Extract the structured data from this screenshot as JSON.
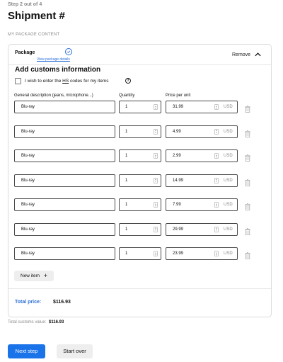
{
  "header": {
    "step": "Step 2 out of 4",
    "title": "Shipment #"
  },
  "section_label": "MY PACKAGE CONTENT",
  "package": {
    "title": "Package",
    "view_details": "View package details",
    "remove_label": "Remove"
  },
  "customs": {
    "title": "Add customs information",
    "hs_label_prefix": "I wish to enter the ",
    "hs_abbr": "HS",
    "hs_label_suffix": " codes for my items",
    "help_glyph": "?",
    "columns": {
      "description": "General description (jeans, microphone...)",
      "quantity": "Quantity",
      "price": "Price per unit"
    },
    "currency": "USD",
    "items": [
      {
        "description": "Blu-ray",
        "quantity": "1",
        "price": "31.99"
      },
      {
        "description": "Blu-ray",
        "quantity": "1",
        "price": "4.99"
      },
      {
        "description": "Blu-ray",
        "quantity": "1",
        "price": "2.99"
      },
      {
        "description": "Blu-ray",
        "quantity": "1",
        "price": "14.99"
      },
      {
        "description": "Blu-ray",
        "quantity": "1",
        "price": "7.99"
      },
      {
        "description": "Blu-ray",
        "quantity": "1",
        "price": "29.99"
      },
      {
        "description": "Blu-ray",
        "quantity": "1",
        "price": "23.99"
      }
    ],
    "new_item_label": "New item",
    "new_item_glyph": "+"
  },
  "totals": {
    "total_label": "Total price:",
    "total_value": "$116.93",
    "customs_value_label": "Total customs value:",
    "customs_value": "$116.93"
  },
  "actions": {
    "next": "Next step",
    "start_over": "Start over"
  },
  "colors": {
    "accent": "#1a73e8",
    "link": "#2a6fd6"
  },
  "icons": {
    "check": "check-circle-icon",
    "collapse": "chevron-up-icon",
    "help": "help-circle-icon",
    "trash": "trash-icon",
    "plus": "plus-icon"
  }
}
